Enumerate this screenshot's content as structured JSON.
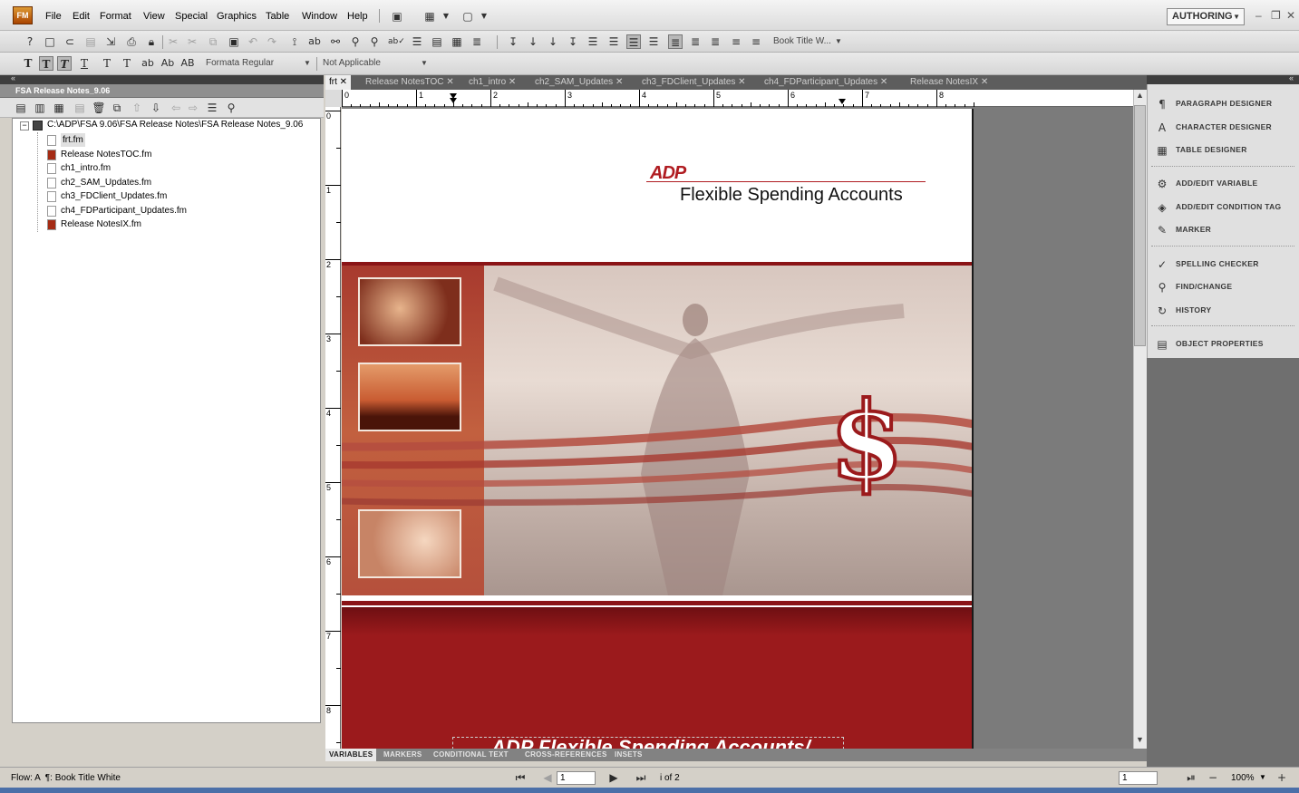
{
  "app": {
    "logo": "FM",
    "workspace": "AUTHORING"
  },
  "menu": [
    "File",
    "Edit",
    "Format",
    "View",
    "Special",
    "Graphics",
    "Table",
    "Window",
    "Help"
  ],
  "toolbar": {
    "paragraph_tag": "Book Title W...",
    "font_name": "Formata Regular",
    "condition": "Not Applicable",
    "text_buttons": [
      "T",
      "T",
      "T",
      "T",
      "T",
      "T",
      "ab",
      "Ab",
      "AB"
    ]
  },
  "book_panel": {
    "title": "FSA Release Notes_9.06",
    "root": "C:\\ADP\\FSA 9.06\\FSA Release Notes\\FSA Release Notes_9.06",
    "files": [
      {
        "name": "frt.fm",
        "selected": true,
        "color": "#ffffff"
      },
      {
        "name": "Release NotesTOC.fm",
        "color": "#a52b14"
      },
      {
        "name": "ch1_intro.fm",
        "color": "#ffffff"
      },
      {
        "name": "ch2_SAM_Updates.fm",
        "color": "#ffffff"
      },
      {
        "name": "ch3_FDClient_Updates.fm",
        "color": "#ffffff"
      },
      {
        "name": "ch4_FDParticipant_Updates.fm",
        "color": "#ffffff"
      },
      {
        "name": "Release NotesIX.fm",
        "color": "#a52b14"
      }
    ]
  },
  "doc_tabs": [
    "frt",
    "Release NotesTOC",
    "ch1_intro",
    "ch2_SAM_Updates",
    "ch3_FDClient_Updates",
    "ch4_FDParticipant_Updates",
    "Release NotesIX"
  ],
  "ruler": {
    "h": [
      "0",
      "1",
      "2",
      "3",
      "4",
      "5",
      "6",
      "7",
      "8"
    ],
    "v": [
      "0",
      "1",
      "2",
      "3",
      "4",
      "5",
      "6",
      "7",
      "8"
    ]
  },
  "page": {
    "logo": "ADP",
    "heading": "Flexible Spending Accounts",
    "footer_text": "ADP Flexible Spending Accounts/",
    "brand_red": "#9b1a1c",
    "dollar": "$"
  },
  "bottom_tabs": [
    "VARIABLES",
    "MARKERS",
    "CONDITIONAL TEXT",
    "CROSS-REFERENCES",
    "INSETS"
  ],
  "right_panel": [
    {
      "label": "PARAGRAPH DESIGNER",
      "icon": "paragraph-designer-icon",
      "glyph": "¶"
    },
    {
      "label": "CHARACTER DESIGNER",
      "icon": "character-designer-icon",
      "glyph": "A"
    },
    {
      "label": "TABLE DESIGNER",
      "icon": "table-designer-icon",
      "glyph": "▦"
    },
    {
      "label": "ADD/EDIT VARIABLE",
      "icon": "variable-icon",
      "glyph": "⚙"
    },
    {
      "label": "ADD/EDIT CONDITION TAG",
      "icon": "condition-tag-icon",
      "glyph": "◈"
    },
    {
      "label": "MARKER",
      "icon": "marker-icon",
      "glyph": "✎"
    },
    {
      "label": "SPELLING CHECKER",
      "icon": "spelling-icon",
      "glyph": "✓"
    },
    {
      "label": "FIND/CHANGE",
      "icon": "find-icon",
      "glyph": "⚲"
    },
    {
      "label": "HISTORY",
      "icon": "history-icon",
      "glyph": "↻"
    },
    {
      "label": "OBJECT PROPERTIES",
      "icon": "object-properties-icon",
      "glyph": "▤"
    }
  ],
  "status": {
    "flow": "Flow: A  ¶: Book Title White",
    "page_field": "1",
    "page_count": "i of 2",
    "right_field": "1",
    "zoom": "100%"
  }
}
